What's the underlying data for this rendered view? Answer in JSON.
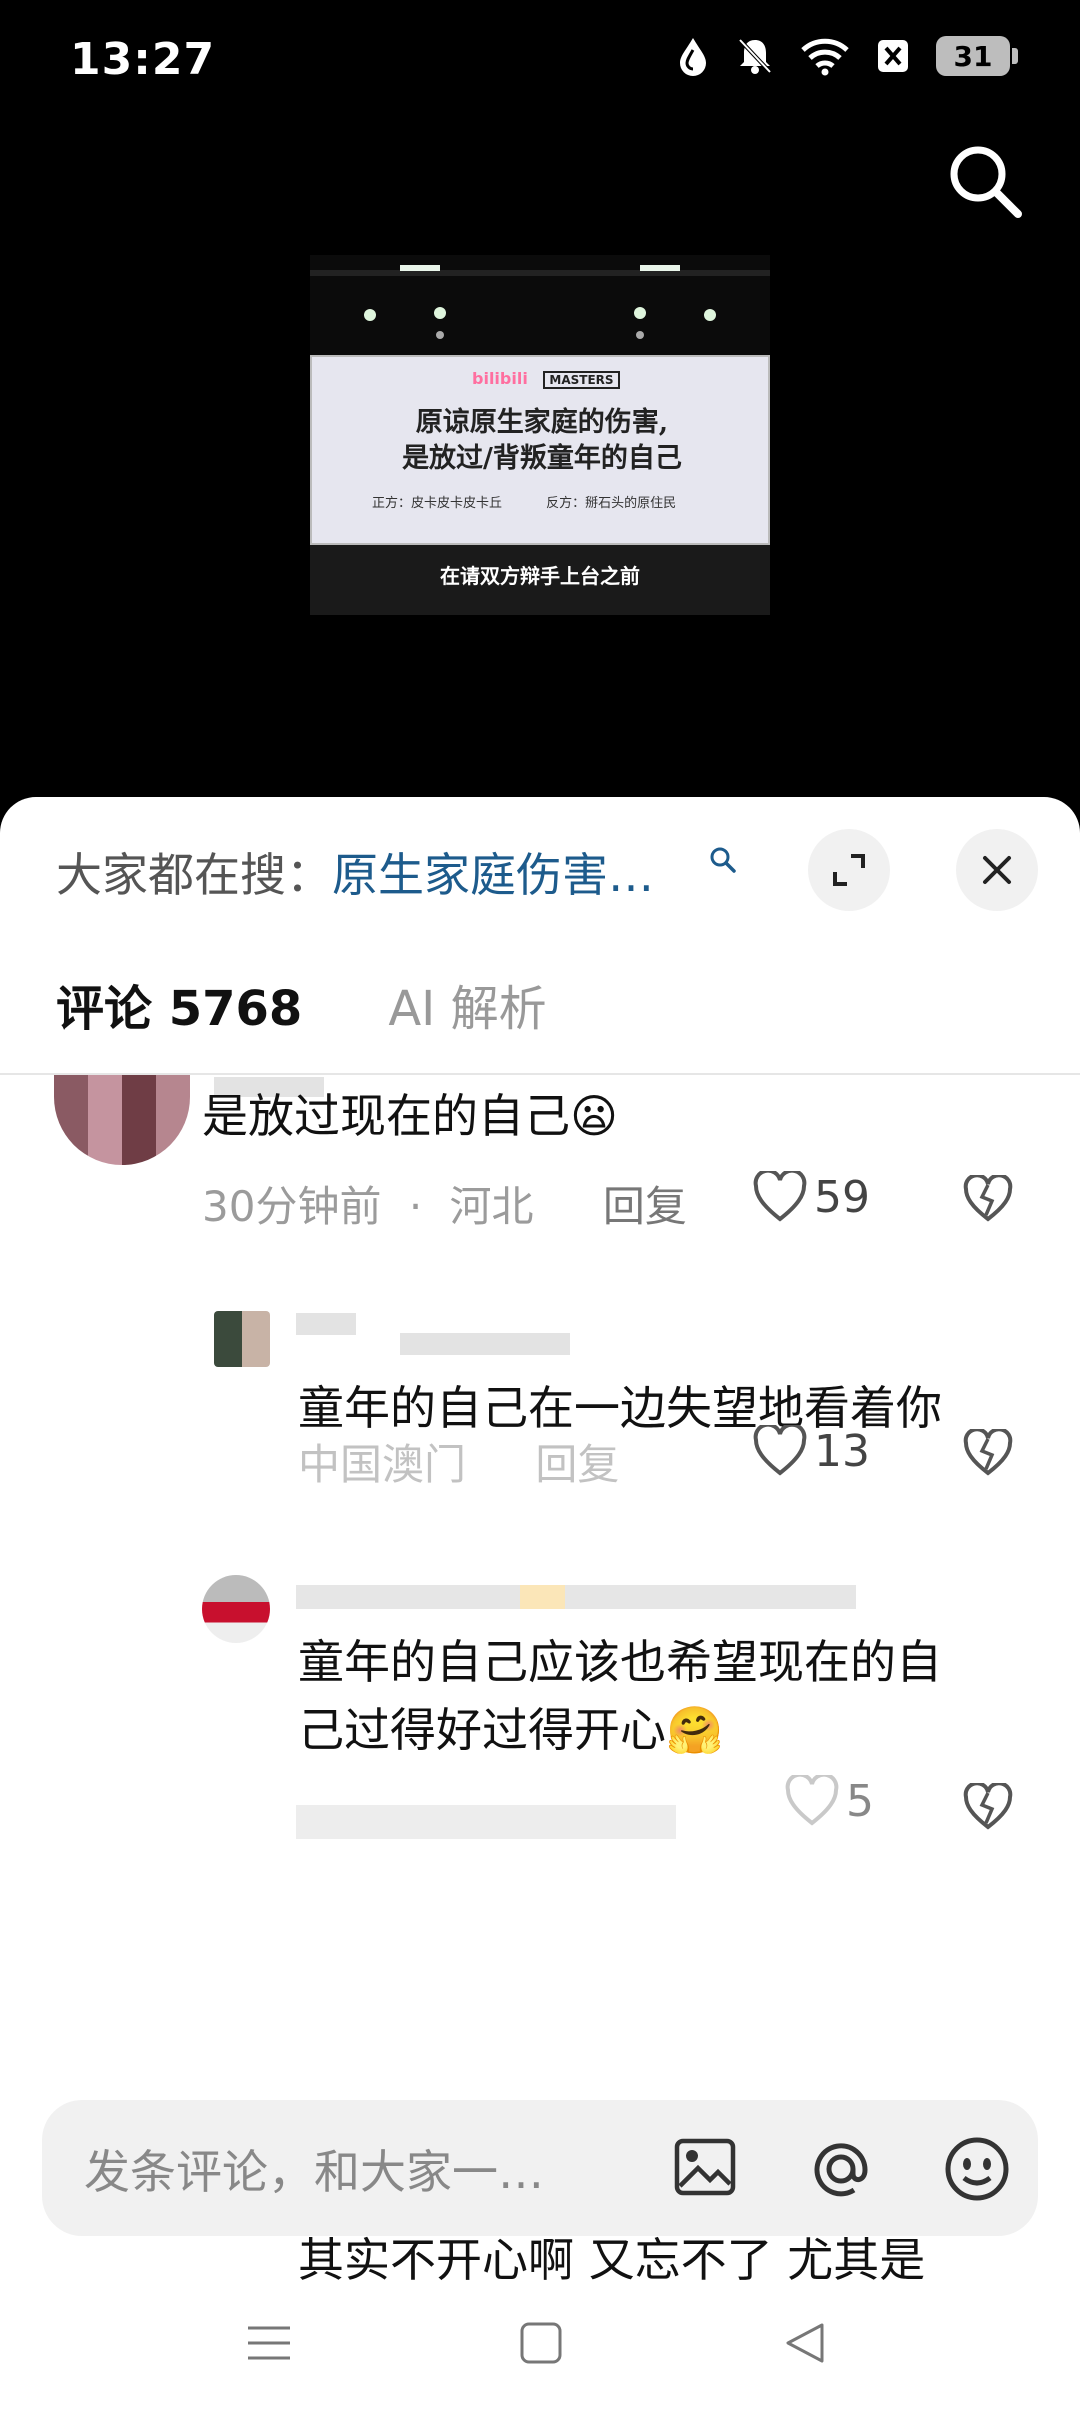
{
  "status_bar": {
    "time": "13:27",
    "battery": "31"
  },
  "video": {
    "screen_title_line1": "原谅原生家庭的伤害,",
    "screen_title_line2": "是放过/背叛童年的自己",
    "screen_pro": "正方：皮卡皮卡皮卡丘",
    "screen_con": "反方：掰石头的原住民",
    "caption": "在请双方辩手上台之前",
    "logo_left": "bilibili",
    "logo_right": "MASTERS"
  },
  "sheet": {
    "suggest_label": "大家都在搜：",
    "suggest_query": "原生家庭伤害…",
    "tabs": [
      {
        "label": "评论 5768"
      },
      {
        "label": "AI 解析"
      }
    ]
  },
  "comments": [
    {
      "text": "是放过现在的自己😦",
      "time": "30分钟前",
      "location": "河北",
      "reply": "回复",
      "likes": "59"
    },
    {
      "text": "童年的自己在一边失望地看着你",
      "location": "中国澳门",
      "reply": "回复",
      "likes": "13"
    },
    {
      "text_line1": "童年的自己应该也希望现在的自",
      "text_line2": "己过得好过得开心🤗",
      "likes": "5"
    },
    {
      "text_line1": "其实不开心啊 又忘不了 尤其是"
    }
  ],
  "input": {
    "placeholder": "发条评论，和大家一…"
  },
  "colors": {
    "accent_link": "#1d5b8c",
    "sheet_bg": "#ffffff",
    "muted": "#9b9b9b"
  }
}
